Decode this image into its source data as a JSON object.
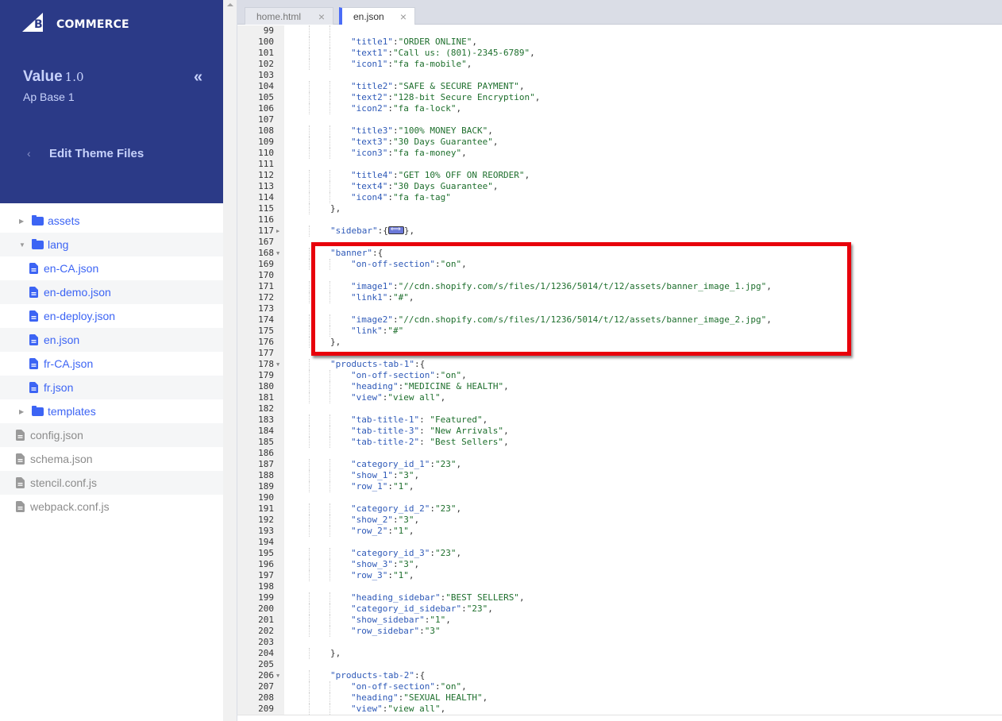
{
  "sidebar": {
    "logo": {
      "big": "BIG",
      "rest": "COMMERCE"
    },
    "theme_name": "Value",
    "theme_version": "1.0",
    "theme_variant": "Ap Base 1",
    "collapse_icon": "«",
    "back_icon": "‹",
    "section_title": "Edit Theme Files",
    "tree": [
      {
        "label": "assets",
        "type": "folder",
        "expanded": false,
        "level": 1
      },
      {
        "label": "lang",
        "type": "folder",
        "expanded": true,
        "level": 1
      },
      {
        "label": "en-CA.json",
        "type": "file",
        "level": 2
      },
      {
        "label": "en-demo.json",
        "type": "file",
        "level": 2
      },
      {
        "label": "en-deploy.json",
        "type": "file",
        "level": 2
      },
      {
        "label": "en.json",
        "type": "file",
        "level": 2
      },
      {
        "label": "fr-CA.json",
        "type": "file",
        "level": 2
      },
      {
        "label": "fr.json",
        "type": "file",
        "level": 2
      },
      {
        "label": "templates",
        "type": "folder",
        "expanded": false,
        "level": 1
      },
      {
        "label": "config.json",
        "type": "root-file",
        "level": 0
      },
      {
        "label": "schema.json",
        "type": "root-file",
        "level": 0
      },
      {
        "label": "stencil.conf.js",
        "type": "root-file",
        "level": 0
      },
      {
        "label": "webpack.conf.js",
        "type": "root-file",
        "level": 0
      }
    ]
  },
  "editor": {
    "tabs": [
      {
        "label": "home.html",
        "active": false,
        "close": "×"
      },
      {
        "label": "en.json",
        "active": true,
        "close": "×"
      }
    ],
    "highlight_color": "#e8000b",
    "lines": [
      {
        "n": "99",
        "indent": 2,
        "key": "",
        "val": "",
        "tail": ""
      },
      {
        "n": "100",
        "indent": 2,
        "key": "\"title1\"",
        "val": "\"ORDER ONLINE\"",
        "tail": ","
      },
      {
        "n": "101",
        "indent": 2,
        "key": "\"text1\"",
        "val": "\"Call us: (801)-2345-6789\"",
        "tail": ","
      },
      {
        "n": "102",
        "indent": 2,
        "key": "\"icon1\"",
        "val": "\"fa fa-mobile\"",
        "tail": ","
      },
      {
        "n": "103",
        "indent": 0,
        "key": "",
        "val": "",
        "tail": ""
      },
      {
        "n": "104",
        "indent": 2,
        "key": "\"title2\"",
        "val": "\"SAFE & SECURE PAYMENT\"",
        "tail": ","
      },
      {
        "n": "105",
        "indent": 2,
        "key": "\"text2\"",
        "val": "\"128-bit Secure Encryption\"",
        "tail": ","
      },
      {
        "n": "106",
        "indent": 2,
        "key": "\"icon2\"",
        "val": "\"fa fa-lock\"",
        "tail": ","
      },
      {
        "n": "107",
        "indent": 0,
        "key": "",
        "val": "",
        "tail": ""
      },
      {
        "n": "108",
        "indent": 2,
        "key": "\"title3\"",
        "val": "\"100% MONEY BACK\"",
        "tail": ","
      },
      {
        "n": "109",
        "indent": 2,
        "key": "\"text3\"",
        "val": "\"30 Days Guarantee\"",
        "tail": ","
      },
      {
        "n": "110",
        "indent": 2,
        "key": "\"icon3\"",
        "val": "\"fa fa-money\"",
        "tail": ","
      },
      {
        "n": "111",
        "indent": 0,
        "key": "",
        "val": "",
        "tail": ""
      },
      {
        "n": "112",
        "indent": 2,
        "key": "\"title4\"",
        "val": "\"GET 10% OFF ON REORDER\"",
        "tail": ","
      },
      {
        "n": "113",
        "indent": 2,
        "key": "\"text4\"",
        "val": "\"30 Days Guarantee\"",
        "tail": ","
      },
      {
        "n": "114",
        "indent": 2,
        "key": "\"icon4\"",
        "val": "\"fa fa-tag\"",
        "tail": ""
      },
      {
        "n": "115",
        "indent": 1,
        "key": "",
        "val": "",
        "tail": "},"
      },
      {
        "n": "116",
        "indent": 0,
        "key": "",
        "val": "",
        "tail": ""
      },
      {
        "n": "117",
        "indent": 1,
        "key": "\"sidebar\"",
        "val": "",
        "tail": "{",
        "folded": true,
        "fold": "▸"
      },
      {
        "n": "167",
        "indent": 0,
        "key": "",
        "val": "",
        "tail": ""
      },
      {
        "n": "168",
        "indent": 1,
        "key": "\"banner\"",
        "val": "",
        "tail": "{",
        "fold": "▾"
      },
      {
        "n": "169",
        "indent": 2,
        "key": "\"on-off-section\"",
        "val": "\"on\"",
        "tail": ","
      },
      {
        "n": "170",
        "indent": 0,
        "key": "",
        "val": "",
        "tail": ""
      },
      {
        "n": "171",
        "indent": 2,
        "key": "\"image1\"",
        "val": "\"//cdn.shopify.com/s/files/1/1236/5014/t/12/assets/banner_image_1.jpg\"",
        "tail": ","
      },
      {
        "n": "172",
        "indent": 2,
        "key": "\"link1\"",
        "val": "\"#\"",
        "tail": ","
      },
      {
        "n": "173",
        "indent": 0,
        "key": "",
        "val": "",
        "tail": ""
      },
      {
        "n": "174",
        "indent": 2,
        "key": "\"image2\"",
        "val": "\"//cdn.shopify.com/s/files/1/1236/5014/t/12/assets/banner_image_2.jpg\"",
        "tail": ","
      },
      {
        "n": "175",
        "indent": 2,
        "key": "\"link\"",
        "val": "\"#\"",
        "tail": ""
      },
      {
        "n": "176",
        "indent": 1,
        "key": "",
        "val": "",
        "tail": "},"
      },
      {
        "n": "177",
        "indent": 0,
        "key": "",
        "val": "",
        "tail": ""
      },
      {
        "n": "178",
        "indent": 1,
        "key": "\"products-tab-1\"",
        "val": "",
        "tail": "{",
        "fold": "▾"
      },
      {
        "n": "179",
        "indent": 2,
        "key": "\"on-off-section\"",
        "val": "\"on\"",
        "tail": ","
      },
      {
        "n": "180",
        "indent": 2,
        "key": "\"heading\"",
        "val": "\"MEDICINE & HEALTH\"",
        "tail": ","
      },
      {
        "n": "181",
        "indent": 2,
        "key": "\"view\"",
        "val": "\"view all\"",
        "tail": ","
      },
      {
        "n": "182",
        "indent": 0,
        "key": "",
        "val": "",
        "tail": ""
      },
      {
        "n": "183",
        "indent": 2,
        "key": "\"tab-title-1\"",
        "val": " \"Featured\"",
        "tail": ","
      },
      {
        "n": "184",
        "indent": 2,
        "key": "\"tab-title-3\"",
        "val": " \"New Arrivals\"",
        "tail": ","
      },
      {
        "n": "185",
        "indent": 2,
        "key": "\"tab-title-2\"",
        "val": " \"Best Sellers\"",
        "tail": ","
      },
      {
        "n": "186",
        "indent": 0,
        "key": "",
        "val": "",
        "tail": ""
      },
      {
        "n": "187",
        "indent": 2,
        "key": "\"category_id_1\"",
        "val": "\"23\"",
        "tail": ","
      },
      {
        "n": "188",
        "indent": 2,
        "key": "\"show_1\"",
        "val": "\"3\"",
        "tail": ","
      },
      {
        "n": "189",
        "indent": 2,
        "key": "\"row_1\"",
        "val": "\"1\"",
        "tail": ","
      },
      {
        "n": "190",
        "indent": 0,
        "key": "",
        "val": "",
        "tail": ""
      },
      {
        "n": "191",
        "indent": 2,
        "key": "\"category_id_2\"",
        "val": "\"23\"",
        "tail": ","
      },
      {
        "n": "192",
        "indent": 2,
        "key": "\"show_2\"",
        "val": "\"3\"",
        "tail": ","
      },
      {
        "n": "193",
        "indent": 2,
        "key": "\"row_2\"",
        "val": "\"1\"",
        "tail": ","
      },
      {
        "n": "194",
        "indent": 0,
        "key": "",
        "val": "",
        "tail": ""
      },
      {
        "n": "195",
        "indent": 2,
        "key": "\"category_id_3\"",
        "val": "\"23\"",
        "tail": ","
      },
      {
        "n": "196",
        "indent": 2,
        "key": "\"show_3\"",
        "val": "\"3\"",
        "tail": ","
      },
      {
        "n": "197",
        "indent": 2,
        "key": "\"row_3\"",
        "val": "\"1\"",
        "tail": ","
      },
      {
        "n": "198",
        "indent": 0,
        "key": "",
        "val": "",
        "tail": ""
      },
      {
        "n": "199",
        "indent": 2,
        "key": "\"heading_sidebar\"",
        "val": "\"BEST SELLERS\"",
        "tail": ","
      },
      {
        "n": "200",
        "indent": 2,
        "key": "\"category_id_sidebar\"",
        "val": "\"23\"",
        "tail": ","
      },
      {
        "n": "201",
        "indent": 2,
        "key": "\"show_sidebar\"",
        "val": "\"1\"",
        "tail": ","
      },
      {
        "n": "202",
        "indent": 2,
        "key": "\"row_sidebar\"",
        "val": "\"3\"",
        "tail": ""
      },
      {
        "n": "203",
        "indent": 0,
        "key": "",
        "val": "",
        "tail": ""
      },
      {
        "n": "204",
        "indent": 1,
        "key": "",
        "val": "",
        "tail": "},"
      },
      {
        "n": "205",
        "indent": 0,
        "key": "",
        "val": "",
        "tail": ""
      },
      {
        "n": "206",
        "indent": 1,
        "key": "\"products-tab-2\"",
        "val": "",
        "tail": "{",
        "fold": "▾"
      },
      {
        "n": "207",
        "indent": 2,
        "key": "\"on-off-section\"",
        "val": "\"on\"",
        "tail": ","
      },
      {
        "n": "208",
        "indent": 2,
        "key": "\"heading\"",
        "val": "\"SEXUAL HEALTH\"",
        "tail": ","
      },
      {
        "n": "209",
        "indent": 2,
        "key": "\"view\"",
        "val": "\"view all\"",
        "tail": ","
      }
    ]
  }
}
